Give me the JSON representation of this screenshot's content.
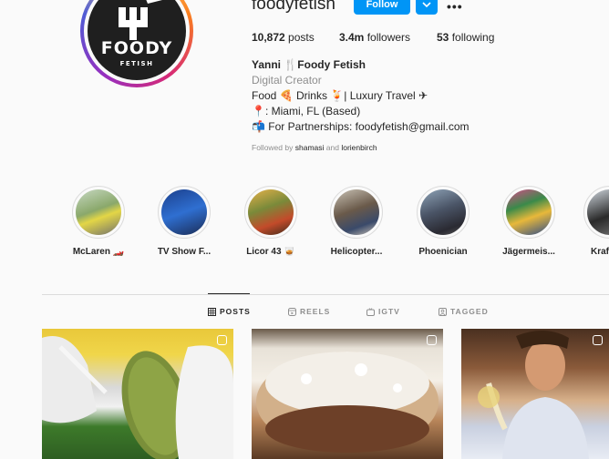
{
  "profile": {
    "username": "foodyfetish",
    "follow_label": "Follow",
    "avatar_logo": "FOODY",
    "avatar_logo_sub": "FETISH",
    "stats": {
      "posts_count": "10,872",
      "posts_label": "posts",
      "followers_count": "3.4m",
      "followers_label": "followers",
      "following_count": "53",
      "following_label": "following"
    },
    "full_name": "Yanni 🍴Foody Fetish",
    "category": "Digital Creator",
    "bio": [
      "Food 🍕 Drinks 🍹| Luxury Travel ✈",
      "📍: Miami, FL (Based)",
      "📬 For Partnerships: foodyfetish@gmail.com"
    ],
    "followed_by_prefix": "Followed by",
    "followed_by_user1": "shamasi",
    "followed_by_and": "and",
    "followed_by_user2": "lorienbirch"
  },
  "highlights": [
    {
      "label": "McLaren 🏎️"
    },
    {
      "label": "TV Show F..."
    },
    {
      "label": "Licor 43 🥃"
    },
    {
      "label": "Helicopter..."
    },
    {
      "label": "Phoenician"
    },
    {
      "label": "Jägermeis..."
    },
    {
      "label": "Kraf"
    }
  ],
  "tabs": [
    {
      "label": "POSTS",
      "icon": "grid-icon"
    },
    {
      "label": "REELS",
      "icon": "reels-icon"
    },
    {
      "label": "IGTV",
      "icon": "igtv-icon"
    },
    {
      "label": "TAGGED",
      "icon": "tagged-icon"
    }
  ],
  "colors": {
    "follow_blue": "#0095f6",
    "muted": "#8e8e8e",
    "text": "#262626"
  }
}
